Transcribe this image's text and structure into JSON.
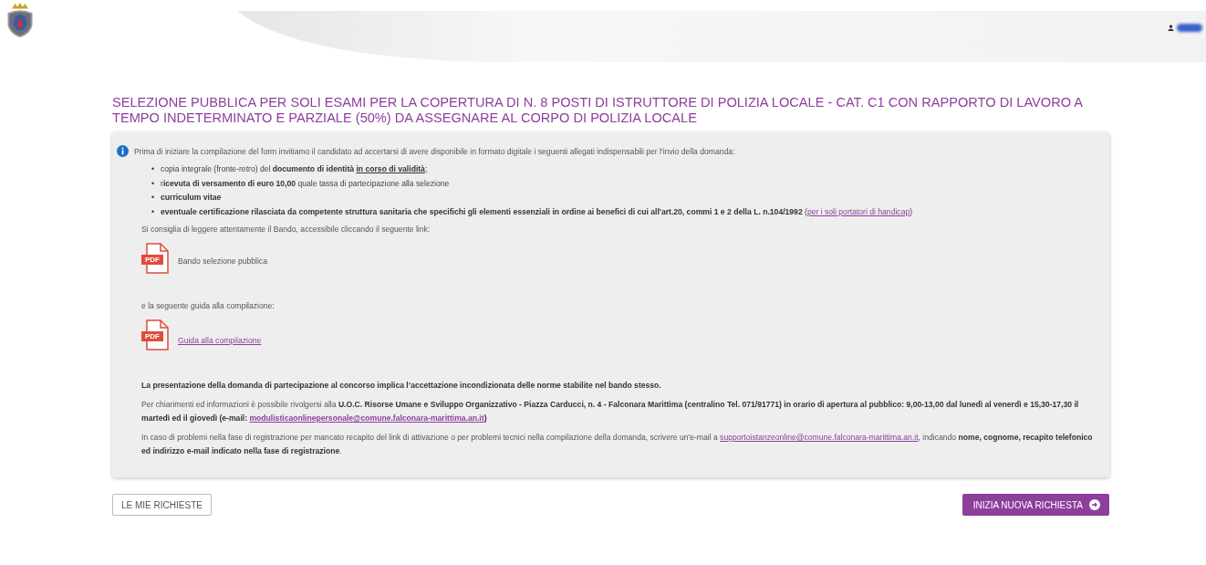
{
  "title": "SELEZIONE PUBBLICA PER SOLI ESAMI PER LA COPERTURA DI N. 8 POSTI DI ISTRUTTORE DI POLIZIA LOCALE - CAT. C1 CON RAPPORTO DI LAVORO A TEMPO INDETERMINATO E PARZIALE (50%) DA ASSEGNARE AL CORPO DI POLIZIA LOCALE",
  "intro": "Prima di iniziare la compilazione del form invitiamo il candidato ad accertarsi di avere disponibile in formato digitale i seguenti allegati indispensabili per l'invio della domanda:",
  "attachments": [
    {
      "marker": "•",
      "parts": [
        {
          "kind": "text",
          "text": "copia integrale (fronte-retro) del **documento di identità** "
        },
        {
          "kind": "underlined",
          "text": "in corso di validità"
        },
        {
          "kind": "text",
          "text": ";"
        }
      ]
    },
    {
      "marker": "•",
      "parts": [
        {
          "kind": "text",
          "text": "r**icevuta di versamento di euro 10,00** quale tassa di partecipazione alla selezione"
        }
      ]
    },
    {
      "marker": "•",
      "parts": [
        {
          "kind": "text",
          "text": "**curriculum vitae**"
        }
      ]
    },
    {
      "marker": "•",
      "parts": [
        {
          "kind": "text",
          "text": "**eventuale certificazione rilasciata da competente struttura sanitaria che specifichi gli elementi essenziali in ordine ai benefici di cui all'art.20, commi 1 e 2 della L. n.104/1992** ("
        },
        {
          "kind": "link",
          "text": "per i soli portatori di handicap"
        },
        {
          "kind": "text",
          "text": ")"
        }
      ]
    }
  ],
  "bando_hint": "Si consiglia di leggere attentamente il Bando, accessibile cliccando il seguente link:",
  "documents": [
    {
      "badge": "PDF",
      "label": "Bando selezione pubblica",
      "is_link": false
    },
    {
      "hint": "e la seguente guida alla compilazione:",
      "badge": "PDF",
      "label": "Guida alla compilazione",
      "is_link": true
    }
  ],
  "notes": [
    [
      {
        "kind": "text",
        "text": "**La presentazione della domanda di partecipazione al concorso implica l’accettazione incondizionata delle norme stabilite nel bando stesso.**"
      }
    ],
    [
      {
        "kind": "text",
        "text": "Per chiarimenti ed informazioni è possibile rivolgersi alla **U.O.C. Risorse Umane e Sviluppo Organizzativo - Piazza Carducci, n. 4 - Falconara Marittima (centralino Tel. 071/91771) in orario di apertura al pubblico: 9,00-13,00 dal lunedì al venerdì e 15,30-17,30 il martedì ed il giovedì (e-mail:** "
      },
      {
        "kind": "boldlink",
        "text": "modulisticaonlinepersonale@comune.falconara-marittima.an.it"
      },
      {
        "kind": "text",
        "text": "**)**"
      }
    ],
    [
      {
        "kind": "text",
        "text": "In caso di problemi nella fase di registrazione per mancato recapito del link di attivazione o per problemi tecnici nella compilazione della domanda, scrivere un'e-mail a "
      },
      {
        "kind": "link",
        "text": "supportoistanzeonline@comune.falconara-marittima.an.it"
      },
      {
        "kind": "text",
        "text": ", indicando **nome, cognome, recapito telefonico ed indirizzo e-mail indicato nella fase di registrazione**."
      }
    ]
  ],
  "buttons": {
    "left": "LE MIE RICHIESTE",
    "right": "INIZIA NUOVA RICHIESTA"
  }
}
